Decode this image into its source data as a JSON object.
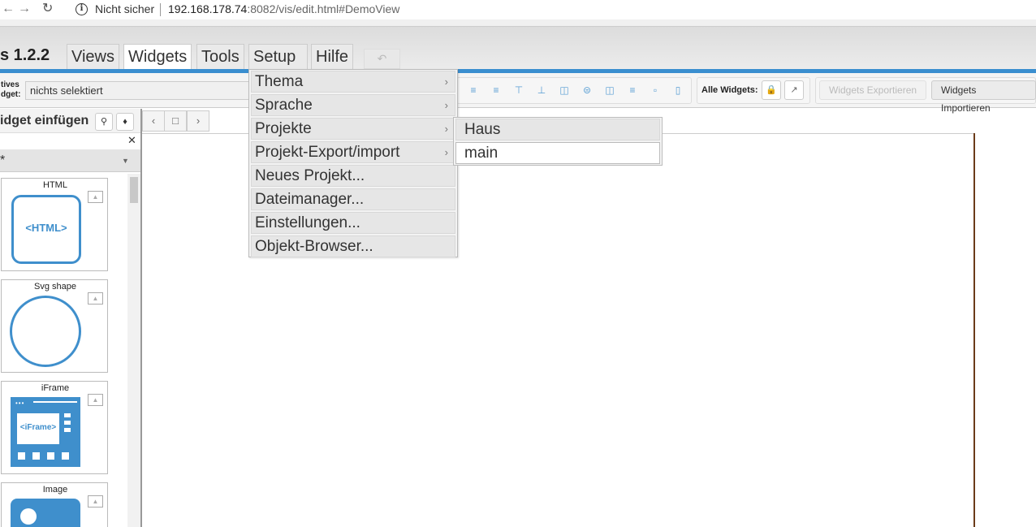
{
  "browser": {
    "security": "Nicht sicher",
    "url_host": "192.168.178.74",
    "url_rest": ":8082/vis/edit.html#DemoView"
  },
  "app": {
    "title": "s 1.2.2",
    "tabs": [
      "Views",
      "Widgets",
      "Tools",
      "Setup",
      "Hilfe"
    ],
    "active_tab": "Widgets"
  },
  "toolbar": {
    "active_widget_label_1": "tives",
    "active_widget_label_2": "dget:",
    "active_widget_value": "nichts selektiert",
    "all_widgets_label": "Alle Widgets:",
    "export_label": "Widgets Exportieren",
    "import_label": "Widgets Importieren"
  },
  "left_panel": {
    "title": "idget einfügen",
    "filter_value": "*",
    "widgets": [
      {
        "label": "HTML",
        "content": "<HTML>"
      },
      {
        "label": "Svg shape"
      },
      {
        "label": "iFrame",
        "content": "<iFrame>"
      },
      {
        "label": "Image"
      }
    ]
  },
  "setup_menu": {
    "items": [
      {
        "label": "Thema",
        "has_submenu": true
      },
      {
        "label": "Sprache",
        "has_submenu": true
      },
      {
        "label": "Projekte",
        "has_submenu": true
      },
      {
        "label": "Projekt-Export/import",
        "has_submenu": true
      },
      {
        "label": "Neues Projekt...",
        "has_submenu": false
      },
      {
        "label": "Dateimanager...",
        "has_submenu": false
      },
      {
        "label": "Einstellungen...",
        "has_submenu": false
      },
      {
        "label": "Objekt-Browser...",
        "has_submenu": false
      }
    ],
    "projects_submenu": [
      "Haus",
      "main"
    ]
  },
  "colors": {
    "accent": "#3a8ecf",
    "widget_icon": "#3f8fcc",
    "canvas_border": "#6b3b1a"
  }
}
